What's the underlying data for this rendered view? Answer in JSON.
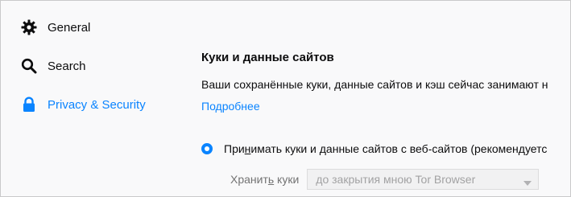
{
  "sidebar": {
    "items": [
      {
        "label": "General",
        "icon": "gear-icon"
      },
      {
        "label": "Search",
        "icon": "search-icon"
      },
      {
        "label": "Privacy & Security",
        "icon": "lock-icon",
        "selected": true
      }
    ]
  },
  "cookies": {
    "heading": "Куки и данные сайтов",
    "description": "Ваши сохранённые куки, данные сайтов и кэш сейчас занимают н",
    "learn_more": "Подробнее",
    "accept_option": {
      "prefix": "При",
      "access_key": "н",
      "suffix": "имать куки и данные сайтов с веб-сайтов (рекомендуетс",
      "selected": true
    },
    "keep_label": {
      "prefix": "Хранит",
      "access_key": "ь",
      "suffix": " куки"
    },
    "keep_select_value": "до закрытия мною Tor Browser"
  },
  "colors": {
    "accent": "#0a84ff",
    "background": "#f9f9fa",
    "text": "#0c0c0d",
    "disabled_text": "#a2a2a3"
  }
}
